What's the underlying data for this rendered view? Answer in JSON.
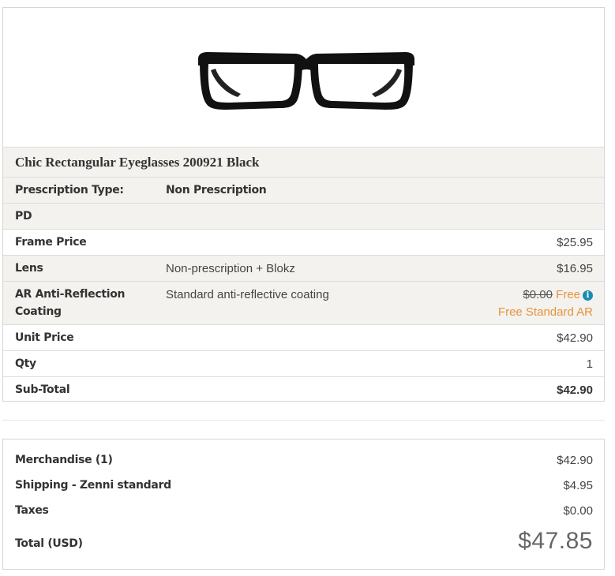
{
  "product": {
    "title": "Chic Rectangular Eyeglasses 200921 Black",
    "image_icon": "eyeglasses-image"
  },
  "rows": {
    "prescription_type": {
      "label": "Prescription Type:",
      "detail": "Non Prescription"
    },
    "pd": {
      "label": "PD"
    },
    "frame_price": {
      "label": "Frame Price",
      "price": "$25.95"
    },
    "lens": {
      "label": "Lens",
      "detail": "Non-prescription + Blokz",
      "price": "$16.95"
    },
    "ar_coating": {
      "label_line1": "AR Anti-Reflection",
      "label_line2": "Coating",
      "detail": "Standard anti-reflective coating",
      "old_price": "$0.00",
      "free": "Free",
      "info_icon": "i",
      "note": "Free Standard AR"
    },
    "unit_price": {
      "label": "Unit Price",
      "price": "$42.90"
    },
    "qty": {
      "label": "Qty",
      "value": "1"
    },
    "subtotal": {
      "label": "Sub-Total",
      "price": "$42.90"
    }
  },
  "summary": {
    "merchandise": {
      "label": "Merchandise (1)",
      "amount": "$42.90"
    },
    "shipping": {
      "label": "Shipping - Zenni standard",
      "amount": "$4.95"
    },
    "taxes": {
      "label": "Taxes",
      "amount": "$0.00"
    },
    "total": {
      "label": "Total (USD)",
      "amount": "$47.85"
    }
  },
  "colors": {
    "accent_orange": "#e8923a",
    "info_blue": "#1a8bb3",
    "shaded_row": "#f3f2ef"
  }
}
